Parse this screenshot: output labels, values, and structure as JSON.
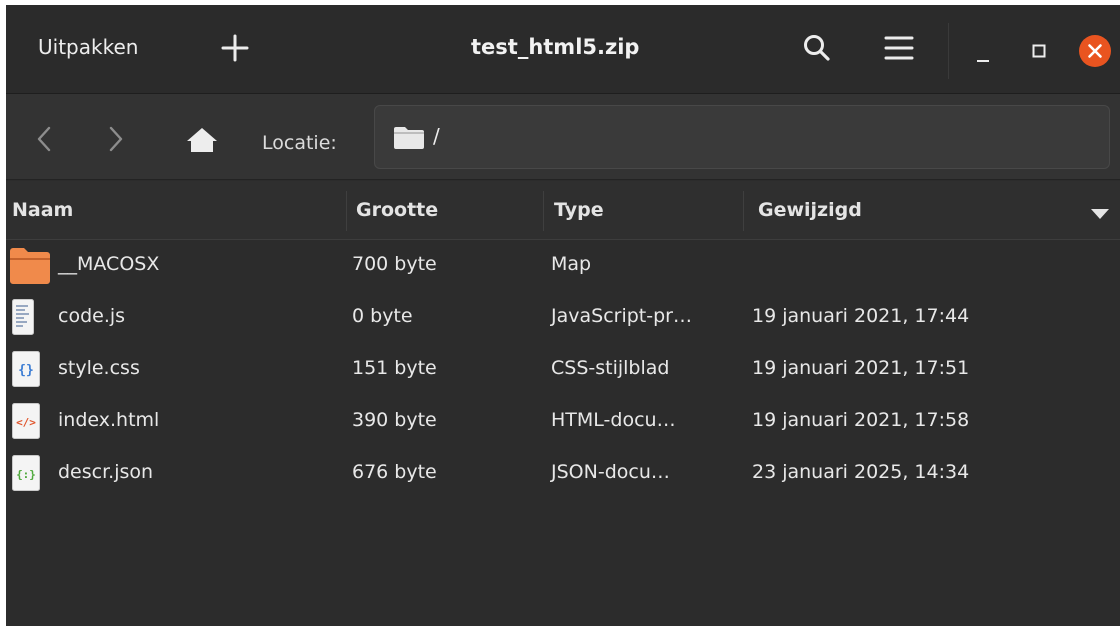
{
  "header": {
    "extract_label": "Uitpakken",
    "title": "test_html5.zip",
    "add_icon": "plus-icon",
    "search_icon": "search-icon",
    "menu_icon": "hamburger-menu-icon",
    "minimize_icon": "minimize-icon",
    "maximize_icon": "maximize-icon",
    "close_icon": "close-icon",
    "close_color": "#e95420"
  },
  "toolbar": {
    "location_label": "Locatie:",
    "path": "/",
    "back_icon": "chevron-left-icon",
    "forward_icon": "chevron-right-icon",
    "home_icon": "home-icon",
    "folder_icon": "folder-icon"
  },
  "columns": [
    "Naam",
    "Grootte",
    "Type",
    "Gewijzigd"
  ],
  "files": [
    {
      "name": "__MACOSX",
      "size": "700 byte",
      "type": "Map",
      "modified": "",
      "icon": "folder-icon"
    },
    {
      "name": "code.js",
      "size": "0 byte",
      "type": "JavaScript-pr…",
      "modified": "19 januari 2021, 17:44",
      "icon": "javascript-file-icon"
    },
    {
      "name": "style.css",
      "size": "151 byte",
      "type": "CSS-stijlblad",
      "modified": "19 januari 2021, 17:51",
      "icon": "css-file-icon"
    },
    {
      "name": "index.html",
      "size": "390 byte",
      "type": "HTML-docu…",
      "modified": "19 januari 2021, 17:58",
      "icon": "html-file-icon"
    },
    {
      "name": "descr.json",
      "size": "676 byte",
      "type": "JSON-docu…",
      "modified": "23 januari 2025, 14:34",
      "icon": "json-file-icon"
    }
  ],
  "colors": {
    "background": "#2c2c2c",
    "accent": "#e95420",
    "folder": "#f08a4b"
  }
}
